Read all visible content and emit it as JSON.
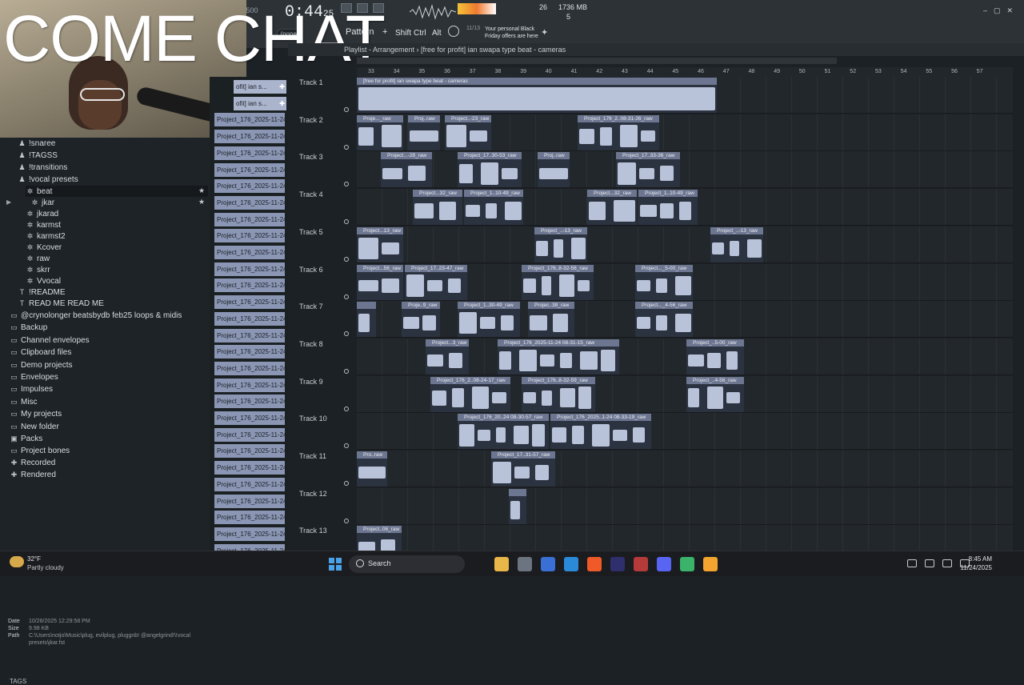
{
  "toolbar": {
    "time_main": "0:44",
    "time_sub": "25",
    "bpm": "2.500",
    "cpu_value": "26",
    "memory": "1736 MB",
    "memory_sub": "5",
    "mixer_none": "(none)",
    "pattern_label": "Pattern",
    "pattern_plus": "+",
    "shift_label": "Shift",
    "ctrl_label": "Ctrl",
    "alt_label": "Alt",
    "news_date": "11/13",
    "news_text": "Your personal Black Friday offers are here"
  },
  "webcam": {
    "overlay_text": "COME CHAT"
  },
  "browser": {
    "items": [
      {
        "label": "!snaree",
        "icon": "user-icon"
      },
      {
        "label": "!TAGSS",
        "icon": "user-icon"
      },
      {
        "label": "!transitions",
        "icon": "user-icon"
      },
      {
        "label": "!vocal presets",
        "icon": "user-icon"
      },
      {
        "label": "beat",
        "icon": "preset-icon"
      },
      {
        "label": "jkar",
        "icon": "preset-icon"
      },
      {
        "label": "jkarad",
        "icon": "preset-icon"
      },
      {
        "label": "karmst",
        "icon": "preset-icon"
      },
      {
        "label": "karmst2",
        "icon": "preset-icon"
      },
      {
        "label": "Kcover",
        "icon": "preset-icon"
      },
      {
        "label": "raw",
        "icon": "preset-icon"
      },
      {
        "label": "skrr",
        "icon": "preset-icon"
      },
      {
        "label": "Vvocal",
        "icon": "preset-icon"
      },
      {
        "label": "!README",
        "icon": "text-icon"
      },
      {
        "label": "READ ME READ ME",
        "icon": "text-icon"
      },
      {
        "label": "@crynolonger beatsbydb feb25 loops & midis",
        "icon": "folder-icon"
      },
      {
        "label": "Backup",
        "icon": "folder-icon"
      },
      {
        "label": "Channel envelopes",
        "icon": "folder-icon"
      },
      {
        "label": "Clipboard files",
        "icon": "folder-icon"
      },
      {
        "label": "Demo projects",
        "icon": "folder-icon"
      },
      {
        "label": "Envelopes",
        "icon": "folder-icon"
      },
      {
        "label": "Impulses",
        "icon": "folder-icon"
      },
      {
        "label": "Misc",
        "icon": "folder-icon"
      },
      {
        "label": "My projects",
        "icon": "folder-icon"
      },
      {
        "label": "New folder",
        "icon": "folder-icon"
      },
      {
        "label": "Packs",
        "icon": "packs-icon"
      },
      {
        "label": "Project bones",
        "icon": "folder-icon"
      },
      {
        "label": "Recorded",
        "icon": "plus-icon"
      },
      {
        "label": "Rendered",
        "icon": "plus-icon"
      }
    ],
    "info": {
      "date_label": "Date",
      "date_value": "10/28/2025 12:29:58 PM",
      "size_label": "Size",
      "size_value": "9.98 KB",
      "path_label": "Path",
      "path_value": "C:\\Users\\notjo\\Music\\plug, evilplug, pluggnb! @angelgrind!\\!vocal presets\\jkar.fst"
    },
    "tags_label": "TAGS"
  },
  "cliplist": {
    "items": [
      "ofit] ian s...",
      "ofit] ian s...",
      "Project_176_2025-11-24...",
      "Project_176_2025-11-24...",
      "Project_176_2025-11-24...",
      "Project_176_2025-11-24...",
      "Project_176_2025-11-24...",
      "Project_176_2025-11-24...",
      "Project_176_2025-11-24...",
      "Project_176_2025-11-24...",
      "Project_176_2025-11-24...",
      "Project_176_2025-11-24...",
      "Project_176_2025-11-24...",
      "Project_176_2025-11-24...",
      "Project_176_2025-11-24...",
      "Project_176_2025-11-24...",
      "Project_176_2025-11-24...",
      "Project_176_2025-11-24...",
      "Project_176_2025-11-24...",
      "Project_176_2025-11-24...",
      "Project_176_2025-11-24...",
      "Project_176_2025-11-24...",
      "Project_176_2025-11-24...",
      "Project_176_2025-11-24...",
      "Project_176_2025-11-24...",
      "Project_176_2025-11-24...",
      "Project_176_2025-11-24...",
      "Project_176_2025-11-24...",
      "Project_176_2025-11-24..."
    ]
  },
  "playlist": {
    "title": "Playlist - Arrangement",
    "pattern_name": "[free for profit] ian  swapa type beat - cameras",
    "ruler": [
      "33",
      "34",
      "35",
      "36",
      "37",
      "38",
      "39",
      "40",
      "41",
      "42",
      "43",
      "44",
      "45",
      "46",
      "47",
      "48",
      "49",
      "50",
      "51",
      "52",
      "53",
      "54",
      "55",
      "56",
      "57"
    ],
    "tracks": [
      {
        "name": "Track 1",
        "clips": [
          {
            "label": "[free for profit] ian  swapa type beat - cameras",
            "start": 0,
            "len": 450
          }
        ]
      },
      {
        "name": "Track 2",
        "clips": [
          {
            "label": "Proje..._raw",
            "start": 0,
            "len": 58
          },
          {
            "label": "Proj..raw",
            "start": 64,
            "len": 40
          },
          {
            "label": "Project..-23_raw",
            "start": 110,
            "len": 58
          },
          {
            "label": "Project_176_2..08-31-26_raw",
            "start": 276,
            "len": 102
          }
        ]
      },
      {
        "name": "Track 3",
        "clips": [
          {
            "label": "Project...-28_raw",
            "start": 30,
            "len": 64
          },
          {
            "label": "Project_17..30-53_raw",
            "start": 126,
            "len": 80
          },
          {
            "label": "Proj..raw",
            "start": 226,
            "len": 40
          },
          {
            "label": "Project_17..33-36_raw",
            "start": 324,
            "len": 80
          }
        ]
      },
      {
        "name": "Track 4",
        "clips": [
          {
            "label": "Project...32_raw",
            "start": 70,
            "len": 62
          },
          {
            "label": "Project_1..10-49_raw",
            "start": 134,
            "len": 74
          },
          {
            "label": "Project...32_raw",
            "start": 288,
            "len": 62
          },
          {
            "label": "Project_1..10-49_raw",
            "start": 352,
            "len": 74
          }
        ]
      },
      {
        "name": "Track 5",
        "clips": [
          {
            "label": "Project...13_raw",
            "start": 0,
            "len": 58
          },
          {
            "label": "Project_..-13_raw",
            "start": 222,
            "len": 66
          },
          {
            "label": "Project_..-13_raw",
            "start": 442,
            "len": 66
          }
        ]
      },
      {
        "name": "Track 6",
        "clips": [
          {
            "label": "Project...56_raw",
            "start": 0,
            "len": 58
          },
          {
            "label": "Project_17..23-47_raw",
            "start": 60,
            "len": 78
          },
          {
            "label": "Project_176..8-32-56_raw",
            "start": 206,
            "len": 90
          },
          {
            "label": "Project..._5-00_raw",
            "start": 348,
            "len": 72
          }
        ]
      },
      {
        "name": "Track 7",
        "clips": [
          {
            "label": "",
            "start": 0,
            "len": 24
          },
          {
            "label": "Proje..9_raw",
            "start": 56,
            "len": 48
          },
          {
            "label": "Project_1..30-49_raw",
            "start": 126,
            "len": 78
          },
          {
            "label": "Projec..38_raw",
            "start": 214,
            "len": 58
          },
          {
            "label": "Project..._4-56_raw",
            "start": 348,
            "len": 72
          }
        ]
      },
      {
        "name": "Track 8",
        "clips": [
          {
            "label": "Project...3_raw",
            "start": 86,
            "len": 54
          },
          {
            "label": "Project_176_2025-11-24 08-31-15_raw",
            "start": 176,
            "len": 152
          },
          {
            "label": "Project_..5-00_raw",
            "start": 412,
            "len": 72
          }
        ]
      },
      {
        "name": "Track 9",
        "clips": [
          {
            "label": "Project_176_2..08-24-17_raw",
            "start": 92,
            "len": 100
          },
          {
            "label": "Project_176..8-32-59_raw",
            "start": 206,
            "len": 92
          },
          {
            "label": "Project_..4-56_raw",
            "start": 412,
            "len": 72
          }
        ]
      },
      {
        "name": "Track 10",
        "clips": [
          {
            "label": "Project_176_20..24 08-30-57_raw",
            "start": 126,
            "len": 114
          },
          {
            "label": "Project_176_2025..1-24 08-33-19_raw",
            "start": 242,
            "len": 126
          }
        ]
      },
      {
        "name": "Track 11",
        "clips": [
          {
            "label": "Pro..raw",
            "start": 0,
            "len": 38
          },
          {
            "label": "Project_17..31-57_raw",
            "start": 168,
            "len": 80
          }
        ]
      },
      {
        "name": "Track 12",
        "clips": [
          {
            "label": "",
            "start": 190,
            "len": 22
          }
        ]
      },
      {
        "name": "Track 13",
        "clips": [
          {
            "label": "Project..06_raw",
            "start": 0,
            "len": 56
          }
        ]
      }
    ]
  },
  "taskbar": {
    "weather_temp": "32°F",
    "weather_desc": "Partly cloudy",
    "search_label": "Search",
    "time": "8:45 AM",
    "date": "11/24/2025",
    "apps": [
      "file-explorer-icon",
      "task-view-icon",
      "vscode-icon",
      "ccleaner-icon",
      "brave-icon",
      "next-icon",
      "voicemeeter-icon",
      "discord-icon",
      "app-icon",
      "fl-studio-icon"
    ]
  }
}
